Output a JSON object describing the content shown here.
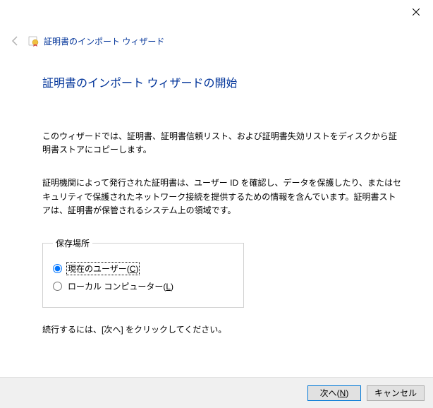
{
  "titlebar": {
    "close_icon": "close"
  },
  "header": {
    "back_icon": "back-arrow",
    "cert_icon": "certificate",
    "title": "証明書のインポート ウィザード"
  },
  "main": {
    "page_title": "証明書のインポート ウィザードの開始",
    "para1": "このウィザードでは、証明書、証明書信頼リスト、および証明書失効リストをディスクから証明書ストアにコピーします。",
    "para2": "証明機関によって発行された証明書は、ユーザー ID を確認し、データを保護したり、またはセキュリティで保護されたネットワーク接続を提供するための情報を含んでいます。証明書ストアは、証明書が保管されるシステム上の領域です。",
    "storage": {
      "legend": "保存場所",
      "opt1_prefix": "現在のユーザー(",
      "opt1_key": "C",
      "opt1_suffix": ")",
      "opt1_selected": true,
      "opt2_prefix": "ローカル コンピューター(",
      "opt2_key": "L",
      "opt2_suffix": ")",
      "opt2_selected": false
    },
    "continue_text": "続行するには、[次へ] をクリックしてください。"
  },
  "buttons": {
    "next_prefix": "次へ(",
    "next_key": "N",
    "next_suffix": ")",
    "cancel": "キャンセル"
  }
}
